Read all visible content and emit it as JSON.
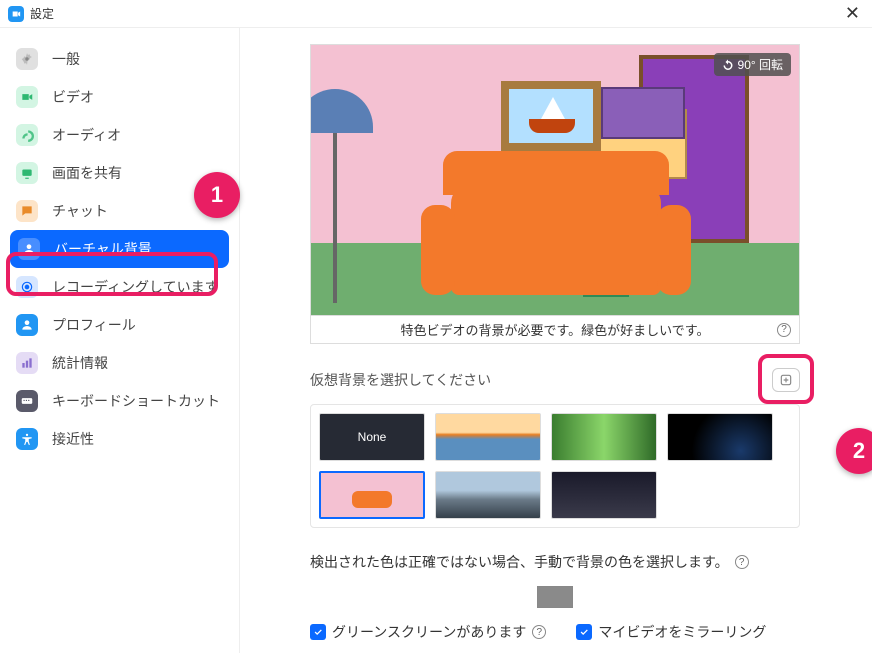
{
  "window": {
    "title": "設定"
  },
  "sidebar": {
    "items": [
      {
        "label": "一般",
        "icon": "gear",
        "color": "#cfcfcf"
      },
      {
        "label": "ビデオ",
        "icon": "video",
        "color": "#4fd08a"
      },
      {
        "label": "オーディオ",
        "icon": "audio",
        "color": "#4fd08a"
      },
      {
        "label": "画面を共有",
        "icon": "share",
        "color": "#4fd08a"
      },
      {
        "label": "チャット",
        "icon": "chat",
        "color": "#f39c4f"
      },
      {
        "label": "バーチャル背景",
        "icon": "person",
        "color": "#0b69ff",
        "active": true
      },
      {
        "label": "レコーディングしています",
        "icon": "record",
        "color": "#0b69ff"
      },
      {
        "label": "プロフィール",
        "icon": "profile",
        "color": "#2196f3"
      },
      {
        "label": "統計情報",
        "icon": "stats",
        "color": "#8a6fcf"
      },
      {
        "label": "キーボードショートカット",
        "icon": "keyboard",
        "color": "#6a6a7a"
      },
      {
        "label": "接近性",
        "icon": "accessibility",
        "color": "#2196f3"
      }
    ]
  },
  "preview": {
    "rotate_label": "90° 回転",
    "caption": "特色ビデオの背景が必要です。緑色が好ましいです。"
  },
  "bg_select": {
    "label": "仮想背景を選択してください",
    "add_tooltip": "+",
    "thumbs": [
      {
        "label": "None",
        "kind": "none"
      },
      {
        "kind": "bridge"
      },
      {
        "kind": "grass"
      },
      {
        "kind": "earth"
      },
      {
        "kind": "room",
        "selected": true
      },
      {
        "kind": "city1"
      },
      {
        "kind": "city2"
      }
    ]
  },
  "color_detect": {
    "text": "検出された色は正確ではない場合、手動で背景の色を選択します。"
  },
  "checkboxes": {
    "greenscreen": "グリーンスクリーンがあります",
    "mirror": "マイビデオをミラーリング"
  },
  "markers": {
    "m1": "1",
    "m2": "2"
  }
}
